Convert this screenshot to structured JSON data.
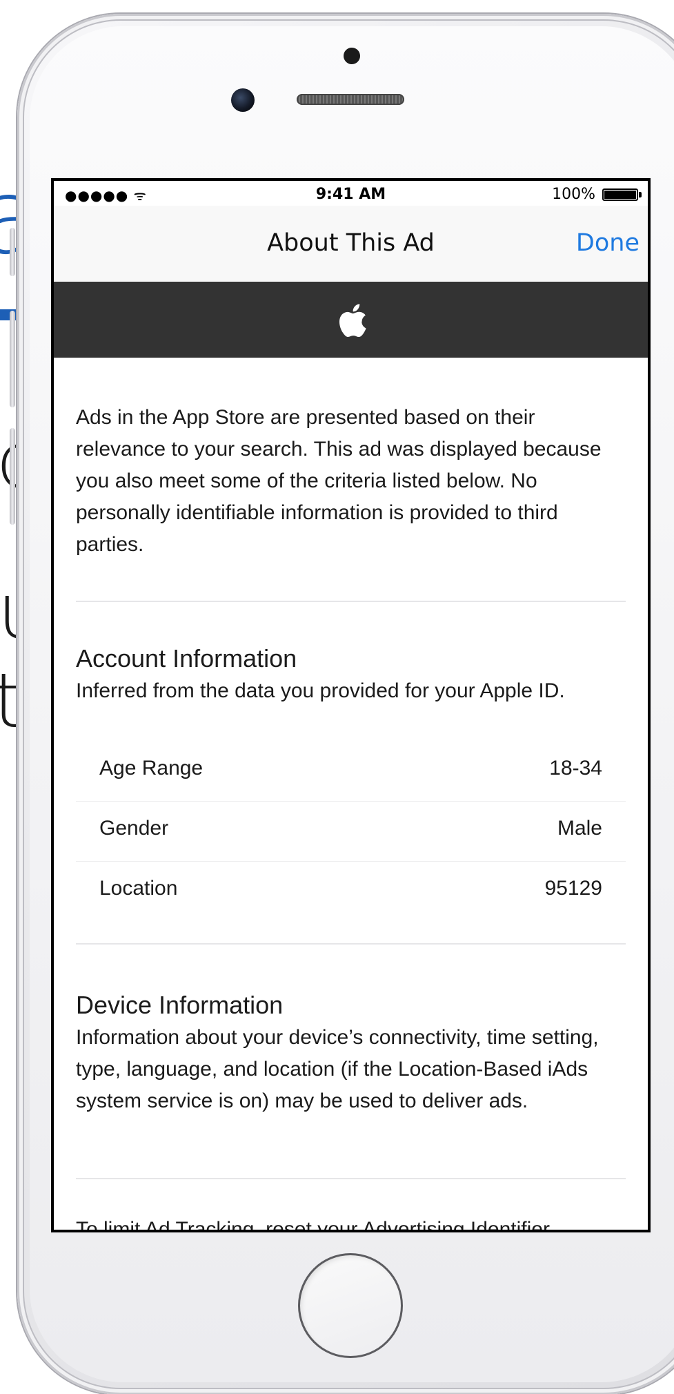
{
  "background": {
    "glyphs": [
      "a",
      "d",
      "u",
      "t"
    ]
  },
  "status_bar": {
    "signal": "●●●●● ᯤ",
    "time": "9:41 AM",
    "battery_text": "100%",
    "battery_level": 1.0
  },
  "nav": {
    "title": "About This Ad",
    "done_label": "Done"
  },
  "banner": {
    "logo_icon": "apple-logo-icon",
    "color": "#333333"
  },
  "intro_text": "Ads in the App Store are presented based on their relevance to your search. This ad was displayed because you also meet some of the criteria listed below. No personally identifiable information is provided to third parties.",
  "account": {
    "title": "Account Information",
    "description": "Inferred from the data you provided for your Apple ID.",
    "rows": [
      {
        "label": "Age Range",
        "value": "18-34"
      },
      {
        "label": "Gender",
        "value": "Male"
      },
      {
        "label": "Location",
        "value": "95129"
      }
    ]
  },
  "device": {
    "title": "Device Information",
    "description": "Information about your device’s connectivity, time setting, type, language, and location (if the Location-Based iAds system service is on) may be used to deliver ads."
  },
  "footer_text": "To limit Ad Tracking, reset your Advertising Identifier",
  "colors": {
    "accent": "#1f7ae0",
    "banner": "#333333"
  }
}
